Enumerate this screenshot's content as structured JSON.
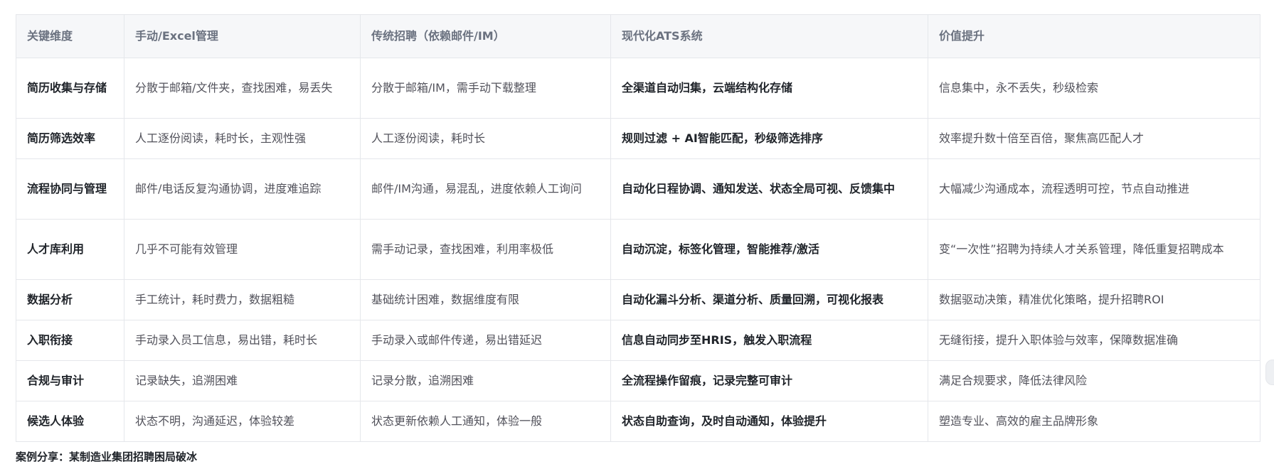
{
  "table": {
    "headers": [
      "关键维度",
      "手动/Excel管理",
      "传统招聘（依赖邮件/IM）",
      "现代化ATS系统",
      "价值提升"
    ],
    "rows": [
      [
        "简历收集与存储",
        "分散于邮箱/文件夹，查找困难，易丢失",
        "分散于邮箱/IM，需手动下载整理",
        "全渠道自动归集，云端结构化存储",
        "信息集中，永不丢失，秒级检索"
      ],
      [
        "简历筛选效率",
        "人工逐份阅读，耗时长，主观性强",
        "人工逐份阅读，耗时长",
        "规则过滤 + AI智能匹配，秒级筛选排序",
        "效率提升数十倍至百倍，聚焦高匹配人才"
      ],
      [
        "流程协同与管理",
        "邮件/电话反复沟通协调，进度难追踪",
        "邮件/IM沟通，易混乱，进度依赖人工询问",
        "自动化日程协调、通知发送、状态全局可视、反馈集中",
        "大幅减少沟通成本，流程透明可控，节点自动推进"
      ],
      [
        "人才库利用",
        "几乎不可能有效管理",
        "需手动记录，查找困难，利用率极低",
        "自动沉淀，标签化管理，智能推荐/激活",
        "变“一次性”招聘为持续人才关系管理，降低重复招聘成本"
      ],
      [
        "数据分析",
        "手工统计，耗时费力，数据粗糙",
        "基础统计困难，数据维度有限",
        "自动化漏斗分析、渠道分析、质量回溯，可视化报表",
        "数据驱动决策，精准优化策略，提升招聘ROI"
      ],
      [
        "入职衔接",
        "手动录入员工信息，易出错，耗时长",
        "手动录入或邮件传递，易出错延迟",
        "信息自动同步至HRIS，触发入职流程",
        "无缝衔接，提升入职体验与效率，保障数据准确"
      ],
      [
        "合规与审计",
        "记录缺失，追溯困难",
        "记录分散，追溯困难",
        "全流程操作留痕，记录完整可审计",
        "满足合规要求，降低法律风险"
      ],
      [
        "候选人体验",
        "状态不明，沟通延迟，体验较差",
        "状态更新依赖人工通知，体验一般",
        "状态自助查询，及时自动通知，体验提升",
        "塑造专业、高效的雇主品牌形象"
      ]
    ]
  },
  "caption": "案例分享：某制造业集团招聘困局破冰"
}
